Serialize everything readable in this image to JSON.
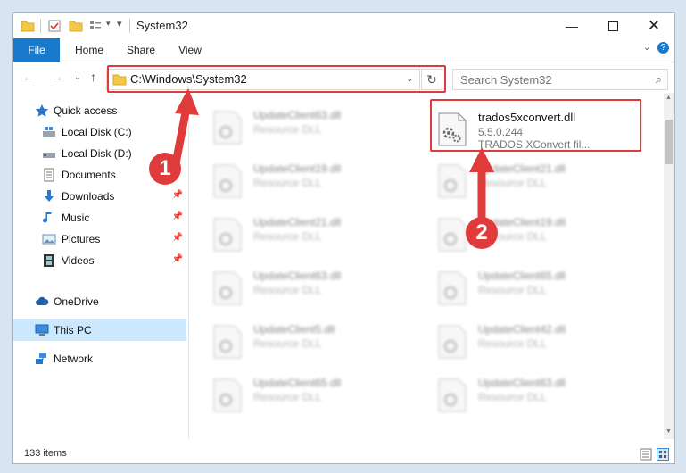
{
  "window": {
    "title": "System32"
  },
  "ribbon": {
    "tabs": [
      "File",
      "Home",
      "Share",
      "View"
    ]
  },
  "address": {
    "path": "C:\\Windows\\System32"
  },
  "search": {
    "placeholder": "Search System32"
  },
  "sidebar": {
    "items": [
      {
        "label": "Quick access",
        "icon": "star-icon",
        "pinned": false
      },
      {
        "label": "Local Disk (C:)",
        "icon": "drive-icon",
        "pinned": false
      },
      {
        "label": "Local Disk (D:)",
        "icon": "drive-icon",
        "pinned": false
      },
      {
        "label": "Documents",
        "icon": "documents-icon",
        "pinned": false
      },
      {
        "label": "Downloads",
        "icon": "download-arrow-icon",
        "pinned": true
      },
      {
        "label": "Music",
        "icon": "music-note-icon",
        "pinned": true
      },
      {
        "label": "Pictures",
        "icon": "pictures-icon",
        "pinned": true
      },
      {
        "label": "Videos",
        "icon": "film-icon",
        "pinned": true
      },
      {
        "label": "OneDrive",
        "icon": "cloud-icon",
        "pinned": false
      },
      {
        "label": "This PC",
        "icon": "monitor-icon",
        "pinned": false
      },
      {
        "label": "Network",
        "icon": "network-icon",
        "pinned": false
      }
    ]
  },
  "files": {
    "highlighted": {
      "name": "trados5xconvert.dll",
      "version": "5.5.0.244",
      "description": "TRADOS XConvert fil..."
    },
    "left_column": [
      {
        "name": "UpdateClient63.dll",
        "type": "Resource DLL"
      },
      {
        "name": "UpdateClient19.dll",
        "type": "Resource DLL"
      },
      {
        "name": "UpdateClient21.dll",
        "type": "Resource DLL"
      },
      {
        "name": "UpdateClient63.dll",
        "type": "Resource DLL"
      },
      {
        "name": "UpdateClient5.dll",
        "type": "Resource DLL"
      },
      {
        "name": "UpdateClient65.dll",
        "type": "Resource DLL"
      }
    ],
    "right_column": [
      {
        "name": "UpdateClient21.dll",
        "type": "Resource DLL"
      },
      {
        "name": "UpdateClient19.dll",
        "type": "Resource DLL"
      },
      {
        "name": "UpdateClient65.dll",
        "type": "Resource DLL"
      },
      {
        "name": "UpdateClient42.dll",
        "type": "Resource DLL"
      },
      {
        "name": "UpdateClient63.dll",
        "type": "Resource DLL"
      }
    ]
  },
  "status": {
    "item_count": "133 items"
  },
  "annotations": {
    "marker1": "1",
    "marker2": "2"
  },
  "colors": {
    "accent": "#1979ca",
    "highlight": "#e03b3b",
    "selected": "#cce8ff"
  }
}
